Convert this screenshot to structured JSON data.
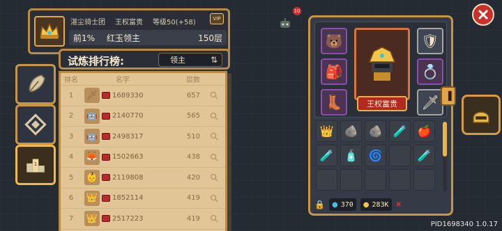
{
  "player": {
    "guild": "湛尘骑士团",
    "title_name": "王权富贵",
    "level_text": "等级50(+58)",
    "rank_pct": "前1%",
    "level_name": "红玉领主",
    "floor": "150层",
    "vip": "VIP"
  },
  "ranking": {
    "title": "试炼排行榜:",
    "selected": "领主",
    "headers": {
      "rank": "排名",
      "name": "名字",
      "floor": "层数"
    },
    "rows": [
      {
        "rank": "1",
        "id": "1689330",
        "floor": "657",
        "avatar": "🗡"
      },
      {
        "rank": "2",
        "id": "2140770",
        "floor": "565",
        "avatar": "🤖"
      },
      {
        "rank": "3",
        "id": "2498317",
        "floor": "510",
        "avatar": "🤖"
      },
      {
        "rank": "4",
        "id": "1502663",
        "floor": "438",
        "avatar": "🦊"
      },
      {
        "rank": "5",
        "id": "2119808",
        "floor": "420",
        "avatar": "👶"
      },
      {
        "rank": "6",
        "id": "1852114",
        "floor": "419",
        "avatar": "👑"
      },
      {
        "rank": "7",
        "id": "2517223",
        "floor": "419",
        "avatar": "👑"
      }
    ]
  },
  "hero": {
    "name": "王权富贵"
  },
  "resources": {
    "gems": "370",
    "gold": "283K"
  },
  "notif_count": "10",
  "version": "PID1698340 1.0.17",
  "colors": {
    "frame": "#c99546",
    "panel": "#e2c596",
    "accent_red": "#b02a1f"
  },
  "icons": {
    "left_nav": [
      "feather-icon",
      "diamond-icon",
      "podium-icon"
    ],
    "close": "close-icon",
    "helmet": "helmet-icon"
  }
}
